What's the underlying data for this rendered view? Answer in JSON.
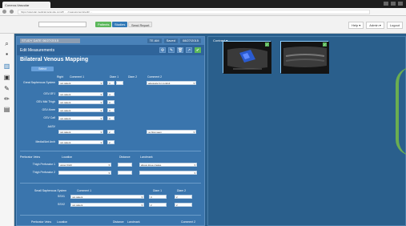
{
  "browser": {
    "tab_title": "Conexa-Vascular",
    "address": "https://vascular.medical-local-site.com/#/ … /measurements/edit/ …"
  },
  "app_bar": {
    "search_placeholder": "",
    "pill_patients": "Patients",
    "pill_studies": "Studies",
    "pill_send": "Send Report",
    "right_items": [
      "Help ▾",
      "Admin ▾",
      "Logout"
    ]
  },
  "left_rail": {
    "icons": [
      "search-icon",
      "record-icon",
      "chart-icon",
      "image-icon",
      "pen-icon",
      "pen-icon",
      "document-icon"
    ]
  },
  "info_strip": {
    "study_text": "STUDY DATE 08/27/2015",
    "right": [
      "TE AM",
      "Saved",
      "08/27/2015"
    ]
  },
  "panel": {
    "title": "Edit Measurements",
    "head_buttons": [
      "⚙",
      "✎",
      "🗑",
      "↗",
      "✔"
    ],
    "form_title": "Bilateral Venous Mapping",
    "select_button": "Select"
  },
  "rows": {
    "header_left": "Right",
    "header_comment": "Comment 1",
    "header_diam1": "Diam 1",
    "header_diam2": "Diam 2",
    "header_comment2": "Comment 2",
    "items": [
      {
        "label": "Great Saphenous System",
        "select": "not patent",
        "d1": "3",
        "d2": "",
        "comment2": "adequate for conduit"
      },
      {
        "label": "GSV-SFJ",
        "select": "not patent",
        "d1": "4",
        "d2": "",
        "comment2": ""
      },
      {
        "label": "GSV-Mid Thigh",
        "select": "not patent",
        "d1": "3",
        "d2": "",
        "comment2": ""
      },
      {
        "label": "GSV-Knee",
        "select": "not patent",
        "d1": "3",
        "d2": "",
        "comment2": ""
      },
      {
        "label": "GSV Calf",
        "select": "not patent",
        "d1": "3",
        "d2": "",
        "comment2": ""
      },
      {
        "label": "AASV",
        "select": "not patent",
        "d1": "2",
        "d2": "",
        "comment2": "no flow seen"
      },
      {
        "label": "Medial/Ant Arch",
        "select": "not patent",
        "d1": "2",
        "d2": "",
        "comment2": ""
      }
    ],
    "perforator_header": {
      "left": "Perforator Veins",
      "location": "Location",
      "distance": "Distance",
      "landmark": "Landmark"
    },
    "perforators": [
      {
        "label": "Thigh Perforator 1",
        "location": "upper thigh",
        "distance": "",
        "landmark": "above knee crease"
      },
      {
        "label": "Thigh Perforator 2",
        "location": "",
        "distance": "",
        "landmark": ""
      }
    ],
    "lower_header": {
      "left": "Small Saphenous System",
      "comment": "Comment 1",
      "d1": "Diam 1",
      "d2": "Diam 2"
    },
    "lower_items": [
      {
        "label": "SSV1",
        "select": "not patent",
        "d1": "3",
        "d2": "2"
      },
      {
        "label": "SSV2",
        "select": "not patent",
        "d1": "2",
        "d2": "2"
      }
    ],
    "bottom_header": {
      "left": "Perforator Veins",
      "location": "Location",
      "distance": "Distance",
      "landmark": "Landmark",
      "comment": "Comment 2"
    }
  },
  "images": {
    "header": "Contrast ▾",
    "thumb_a_label": "",
    "thumb_b_label": ""
  },
  "colors": {
    "panel_bg": "#3a75ad",
    "accent_green": "#5cb85c",
    "app_bar": "#f2f2f2"
  }
}
